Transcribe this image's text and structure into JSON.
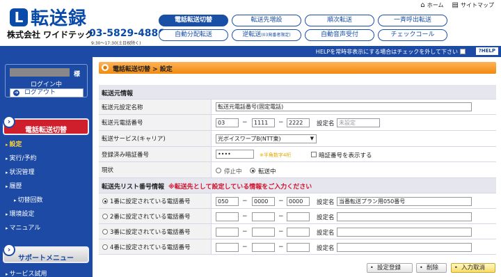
{
  "header": {
    "logo_mark": "L",
    "logo_text": "転送録",
    "company": "株式会社 ワイドテック",
    "tel": "03-5829-4886",
    "hours": "9:30〜17:30(土日祝除く)",
    "home_label": "ホーム",
    "sitemap_label": "サイトマップ",
    "home_icon": "home-icon",
    "sitemap_icon": "sitemap-icon"
  },
  "nav": {
    "row1": [
      "電話転送切替",
      "転送先増設",
      "順次転送",
      "一斉呼出転送"
    ],
    "row2": [
      "自動分配転送",
      "逆転送",
      "自動音声受付",
      "チェックコール"
    ],
    "row2_note": "(03発番者限定)"
  },
  "band": {
    "text": "HELPを常時非表示にする場合はチェックを外して下さい",
    "help": "?HELP"
  },
  "sidebar": {
    "sama": "様",
    "login_status": "ログイン中",
    "logout": "ログアウト",
    "section_active": "電話転送切替",
    "items": [
      "設定",
      "実行/予約",
      "状況管理",
      "履歴",
      "切替回数",
      "環境設定",
      "マニュアル"
    ],
    "section_support": "サポートメニュー",
    "support_items": [
      "サービス試用"
    ]
  },
  "main": {
    "breadcrumb": "電話転送切替 > 設定",
    "source_section": "転送元情報",
    "fields": {
      "name_label": "転送元設定名称",
      "name_value": "転送元電話番号(固定電話)",
      "phone_label": "転送元電話番号",
      "phone": [
        "03",
        "1111",
        "2222"
      ],
      "setting_name_label": "設定名",
      "setting_name_placeholder": "未設定",
      "service_label": "転送サービス(キャリア)",
      "service_value": "光ボイスワープB(NTT東)",
      "pin_label": "登録済み暗証番号",
      "pin_value": "••••",
      "pin_hint": "※半角数字4桁",
      "show_pin_label": "暗証番号を表示する",
      "status_label": "現状",
      "status_options": [
        "停止中",
        "転送中"
      ],
      "status_selected": "転送中"
    },
    "dest_section": "転送先リスト番号情報",
    "dest_warning": "※転送先として設定している情報をご入力ください",
    "dest_rows": [
      {
        "label": "1番に設定されている電話番号",
        "phone": [
          "050",
          "0000",
          "0000"
        ],
        "name": "当番転送プラン用050番号",
        "selected": true
      },
      {
        "label": "2番に設定されている電話番号",
        "phone": [
          "",
          "",
          ""
        ],
        "name": "",
        "selected": false
      },
      {
        "label": "3番に設定されている電話番号",
        "phone": [
          "",
          "",
          ""
        ],
        "name": "",
        "selected": false
      },
      {
        "label": "4番に設定されている電話番号",
        "phone": [
          "",
          "",
          ""
        ],
        "name": "",
        "selected": false
      }
    ],
    "dest_name_label": "設定名",
    "dash": "−",
    "buttons": {
      "register": "設定登録",
      "delete": "削除",
      "cancel": "入力取消"
    }
  },
  "colors": {
    "brand_blue": "#1c4aa4",
    "active_red": "#cf1e2c",
    "header_orange": "#f08a10",
    "warning_red": "#d0102a"
  }
}
